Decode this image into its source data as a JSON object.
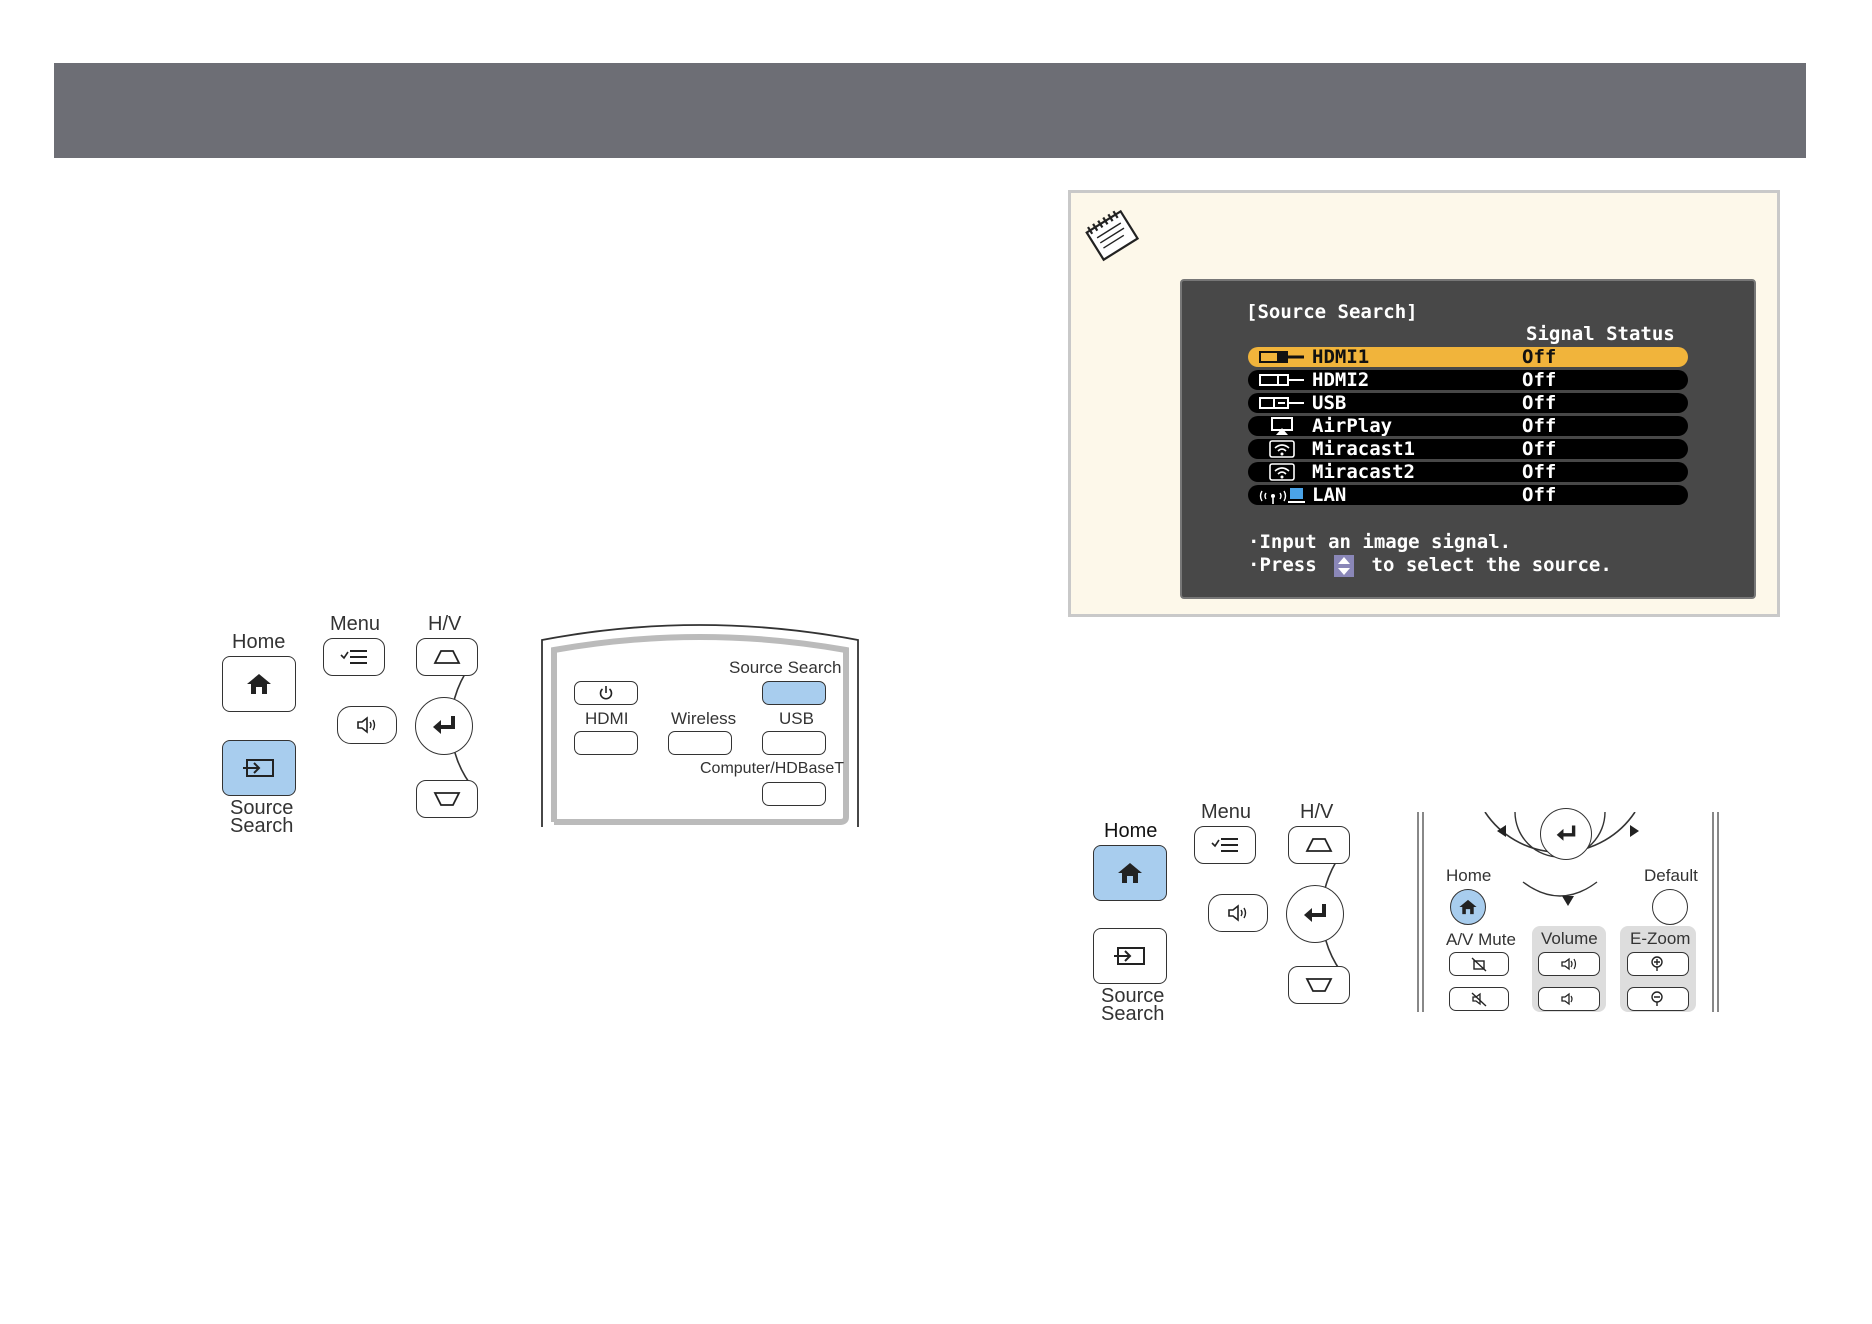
{
  "remote_a": {
    "home": "Home",
    "menu": "Menu",
    "hv": "H/V",
    "source_search_1": "Source",
    "source_search_2": "Search"
  },
  "control_panel": {
    "source_search": "Source Search",
    "hdmi": "HDMI",
    "wireless": "Wireless",
    "usb": "USB",
    "computer": "Computer/HDBaseT"
  },
  "osd": {
    "title": "[Source Search]",
    "column_header": "Signal Status",
    "rows": [
      {
        "name": "HDMI1",
        "status": "Off",
        "icon": "hdmi-cable-icon"
      },
      {
        "name": "HDMI2",
        "status": "Off",
        "icon": "hdmi-cable-icon"
      },
      {
        "name": "USB",
        "status": "Off",
        "icon": "usb-cable-icon"
      },
      {
        "name": "AirPlay",
        "status": "Off",
        "icon": "airplay-icon"
      },
      {
        "name": "Miracast1",
        "status": "Off",
        "icon": "wifi-display-icon"
      },
      {
        "name": "Miracast2",
        "status": "Off",
        "icon": "wifi-display-icon"
      },
      {
        "name": "LAN",
        "status": "Off",
        "icon": "lan-icon"
      }
    ],
    "hint1": "·Input an image signal.",
    "hint2_pre": "·Press",
    "hint2_post": "to select the source."
  },
  "remote_b": {
    "home": "Home",
    "menu": "Menu",
    "hv": "H/V",
    "source_search_1": "Source",
    "source_search_2": "Search"
  },
  "remote_c": {
    "home": "Home",
    "default": "Default",
    "av_mute": "A/V Mute",
    "volume": "Volume",
    "ezoom": "E-Zoom"
  },
  "colors": {
    "header": "#6d6e75",
    "note_bg": "#fdf8ea",
    "highlight_button": "#a8cdee",
    "osd_selected": "#f1b43b"
  }
}
